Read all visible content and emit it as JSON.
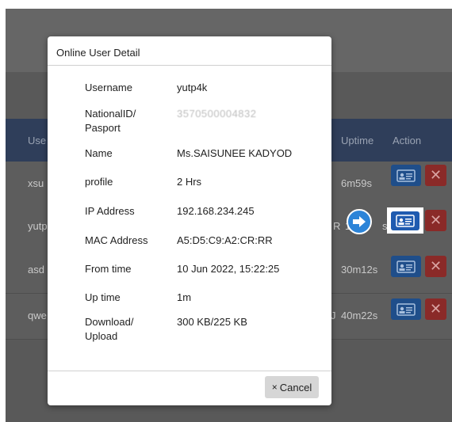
{
  "background_table": {
    "header": {
      "user_col": "Use",
      "uptime_col": "Uptime",
      "action_col": "Action"
    },
    "rows": [
      {
        "user": "xsu",
        "uptime": "6m59s"
      },
      {
        "user": "yutp",
        "uptime": "s",
        "extra": "R",
        "prefix": "1"
      },
      {
        "user": "asd",
        "uptime": "30m12s"
      },
      {
        "user": "qwe",
        "uptime": "40m22s",
        "extra": "J"
      }
    ]
  },
  "modal": {
    "title": "Online User Detail",
    "fields": [
      {
        "label": "Username",
        "value": "yutp4k"
      },
      {
        "label_line1": "NationalID/",
        "label_line2": "Pasport",
        "value": "3570500004832"
      },
      {
        "label": "Name",
        "value": "Ms.SAISUNEE KADYOD"
      },
      {
        "label": "profile",
        "value": "2 Hrs"
      },
      {
        "label": "IP Address",
        "value": "192.168.234.245"
      },
      {
        "label": "MAC Address",
        "value": "A5:D5:C9:A2:CR:RR"
      },
      {
        "label": "From time",
        "value": "10 Jun 2022, 15:22:25"
      },
      {
        "label": "Up time",
        "value": "1m"
      },
      {
        "label_line1": "Download/",
        "label_line2": "Upload",
        "value": "300 KB/225 KB"
      }
    ],
    "cancel_label": "Cancel",
    "cancel_icon": "×"
  },
  "colors": {
    "action_button": "#1f4e8a",
    "delete_button": "#8a2a28",
    "highlight_arrow": "#2c84d8"
  }
}
